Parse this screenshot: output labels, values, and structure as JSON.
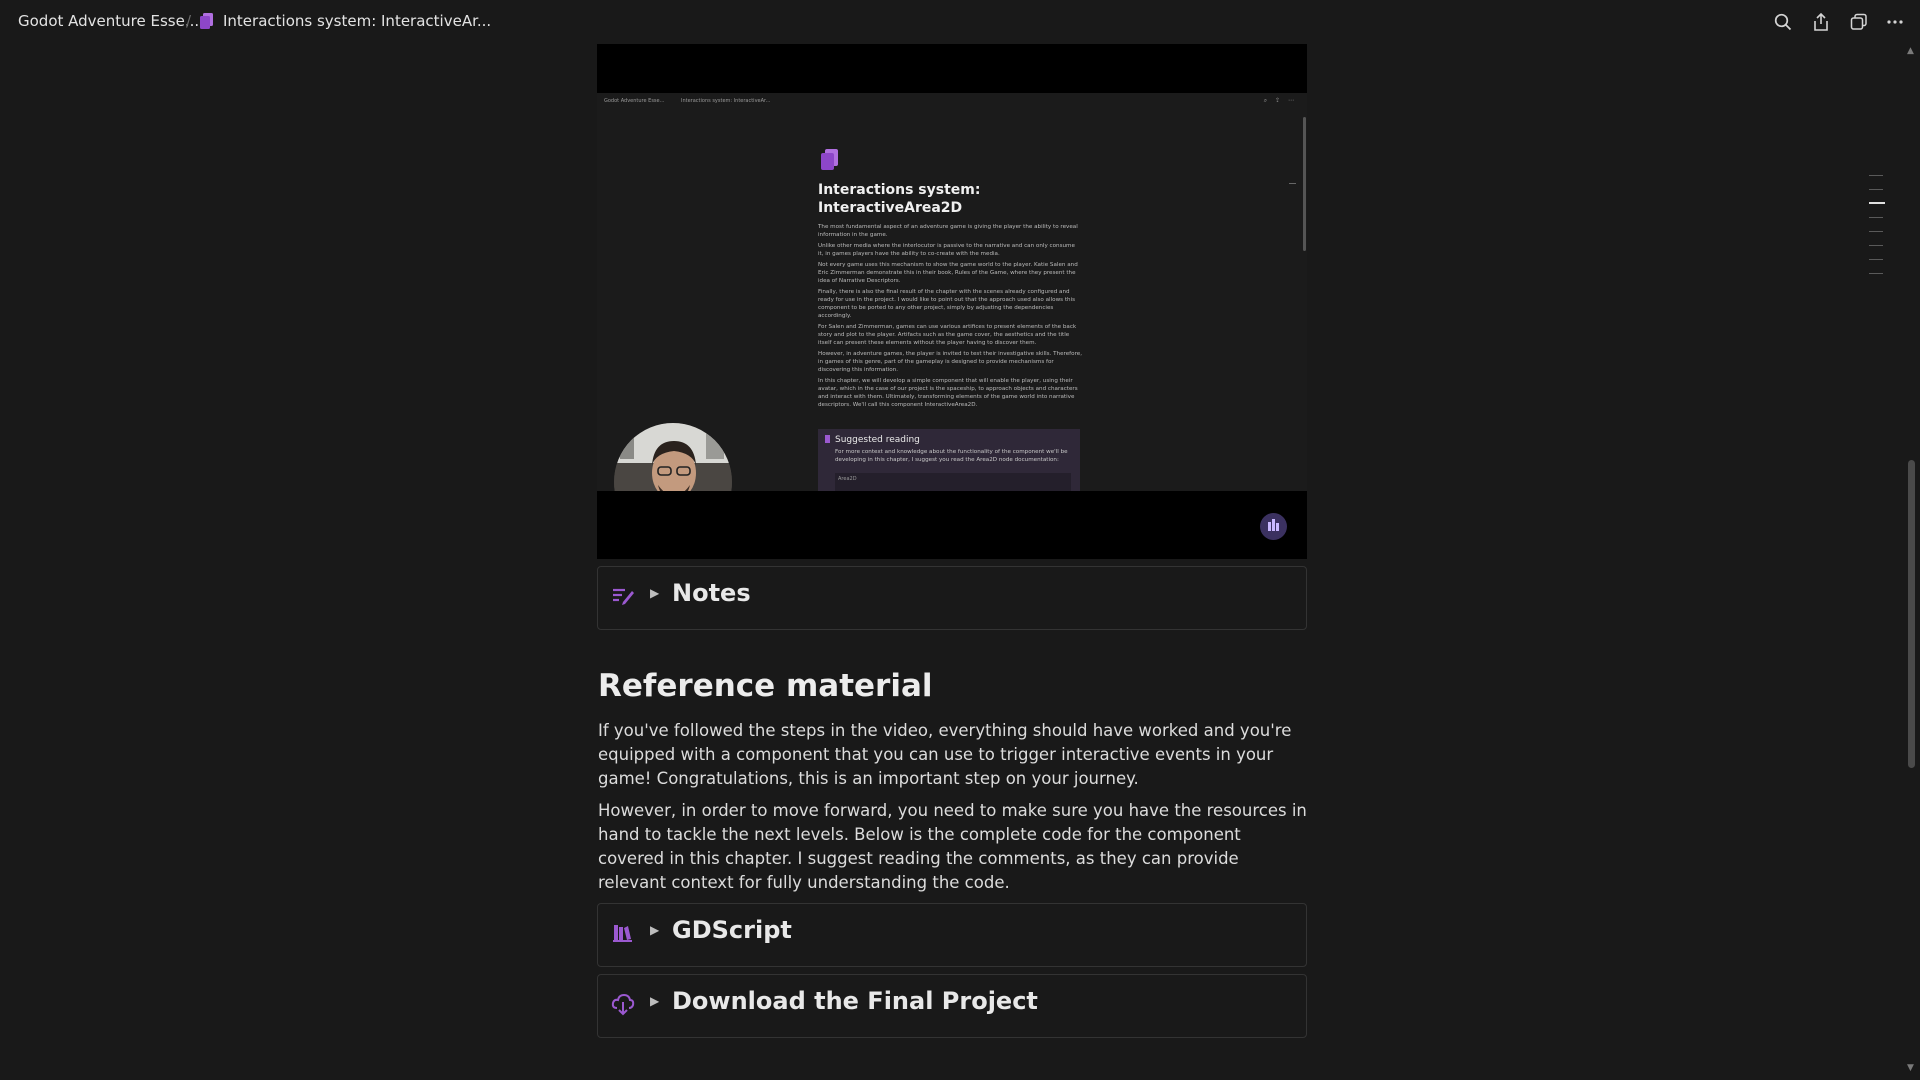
{
  "header": {
    "breadcrumb_parent": "Godot Adventure Esse...",
    "breadcrumb_current": "Interactions system: InteractiveAr...",
    "actions": [
      "search-icon",
      "share-icon",
      "duplicate-icon",
      "more-icon"
    ]
  },
  "video": {
    "mini_breadcrumb_parent": "Godot Adventure Esse...",
    "mini_breadcrumb_current": "Interactions system: InteractiveAr...",
    "mini_title": "Interactions system: InteractiveArea2D",
    "mini_paragraphs": [
      "The most fundamental aspect of an adventure game is giving the player the ability to reveal information in the game.",
      "Unlike other media where the interlocutor is passive to the narrative and can only consume it, in games players have the ability to co-create with the media.",
      "Not every game uses this mechanism to show the game world to the player. Katie Salen and Eric Zimmerman demonstrate this in their book, Rules of the Game, where they present the idea of Narrative Descriptors.",
      "Finally, there is also the final result of the chapter with the scenes already configured and ready for use in the project. I would like to point out that the approach used also allows this component to be ported to any other project, simply by adjusting the dependencies accordingly.",
      "For Salen and Zimmerman, games can use various artifices to present elements of the back story and plot to the player. Artifacts such as the game cover, the aesthetics and the title itself can present these elements without the player having to discover them.",
      "However, in adventure games, the player is invited to test their investigative skills. Therefore, in games of this genre, part of the gameplay is designed to provide mechanisms for discovering this information.",
      "In this chapter, we will develop a simple component that will enable the player, using their avatar, which in the case of our project is the spaceship, to approach objects and characters and interact with them. Ultimately, transforming elements of the game world into narrative descriptors. We'll call this component InteractiveArea2D."
    ],
    "mini_callout_title": "Suggested reading",
    "mini_callout_text": "For more context and knowledge about the functionality of the component we'll be developing in this chapter, I suggest you read the Area2D node documentation:",
    "mini_code": "Area2D"
  },
  "notes_toggle": {
    "label": "Notes",
    "icon": "notes-icon"
  },
  "reference": {
    "heading": "Reference material",
    "paragraph_1": "If you've followed the steps in the video, everything should have worked and you're equipped with a component that you can use to trigger interactive events in your game! Congratulations, this is an important step on your journey.",
    "paragraph_2": "However, in order to move forward, you need to make sure you have the resources in hand to tackle the next levels. Below is the complete code for the component covered in this chapter. I suggest reading the comments, as they can provide relevant context for fully understanding the code."
  },
  "gdscript_toggle": {
    "label": "GDScript",
    "icon": "books-icon"
  },
  "download_toggle": {
    "label": "Download the Final Project",
    "icon": "cloud-download-icon"
  },
  "colors": {
    "accent": "#9b59d0",
    "background": "#191919",
    "text": "#e6e6e6"
  }
}
